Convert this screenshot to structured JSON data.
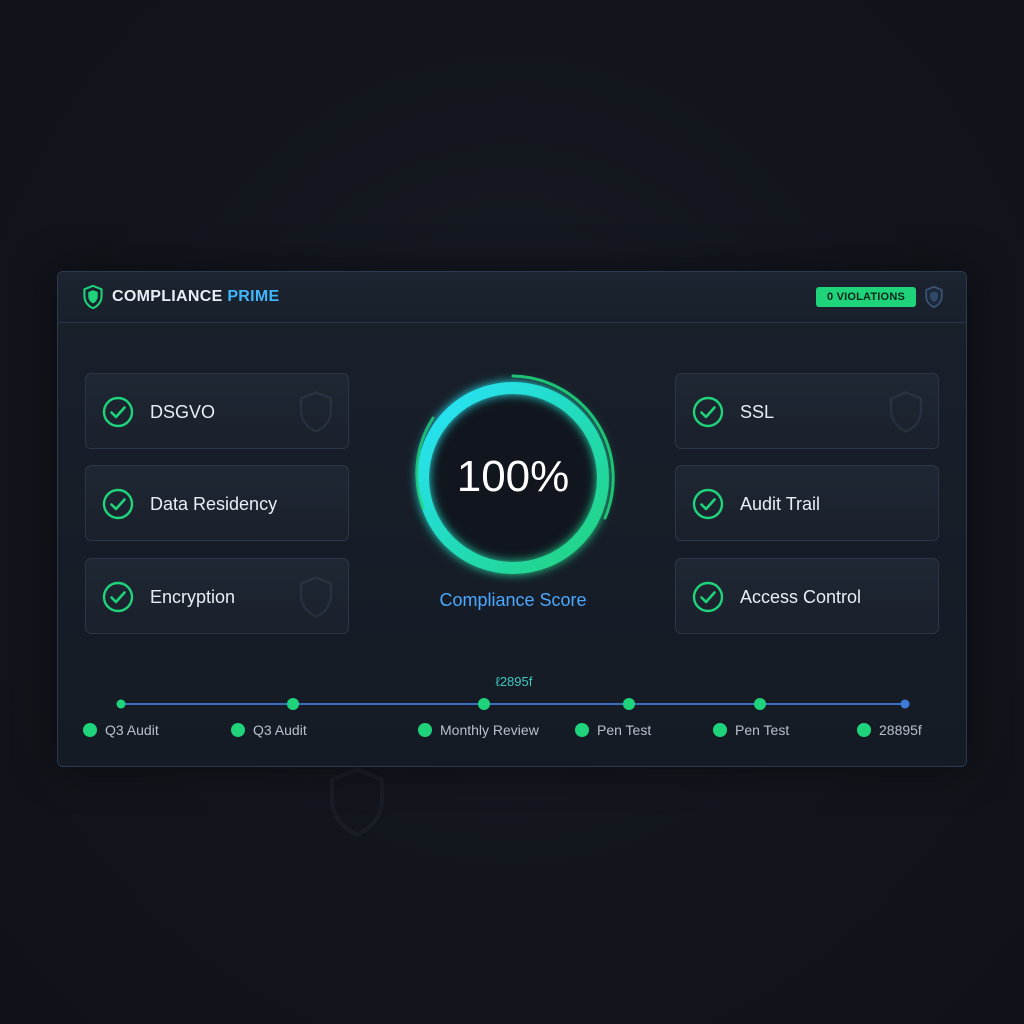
{
  "app": {
    "title_part1": "COMPLIANCE",
    "title_part2": "PRIME",
    "violations_badge": "0 VIOLATIONS",
    "icons": {
      "brand": "shield-icon",
      "header_right": "shield-icon"
    }
  },
  "checks_left": [
    {
      "label": "DSGVO",
      "status": "passed"
    },
    {
      "label": "Data Residency",
      "status": "passed"
    },
    {
      "label": "Encryption",
      "status": "passed"
    }
  ],
  "checks_right": [
    {
      "label": "SSL",
      "status": "passed"
    },
    {
      "label": "Audit Trail",
      "status": "passed"
    },
    {
      "label": "Access Control",
      "status": "passed"
    }
  ],
  "score": {
    "value_text": "100%",
    "fraction": 1.0,
    "label": "Compliance Score"
  },
  "timeline": {
    "top_label": "ℓ2895f",
    "events": [
      {
        "label": "Q3 Audit"
      },
      {
        "label": "Q3 Audit"
      },
      {
        "label": "Monthly Review"
      },
      {
        "label": "Pen Test"
      },
      {
        "label": "Pen Test"
      },
      {
        "label": "28895f"
      }
    ]
  },
  "colors": {
    "accent_green": "#1fd37a",
    "accent_blue": "#3fb7ff",
    "background": "#11141b",
    "panel": "#18202b"
  }
}
